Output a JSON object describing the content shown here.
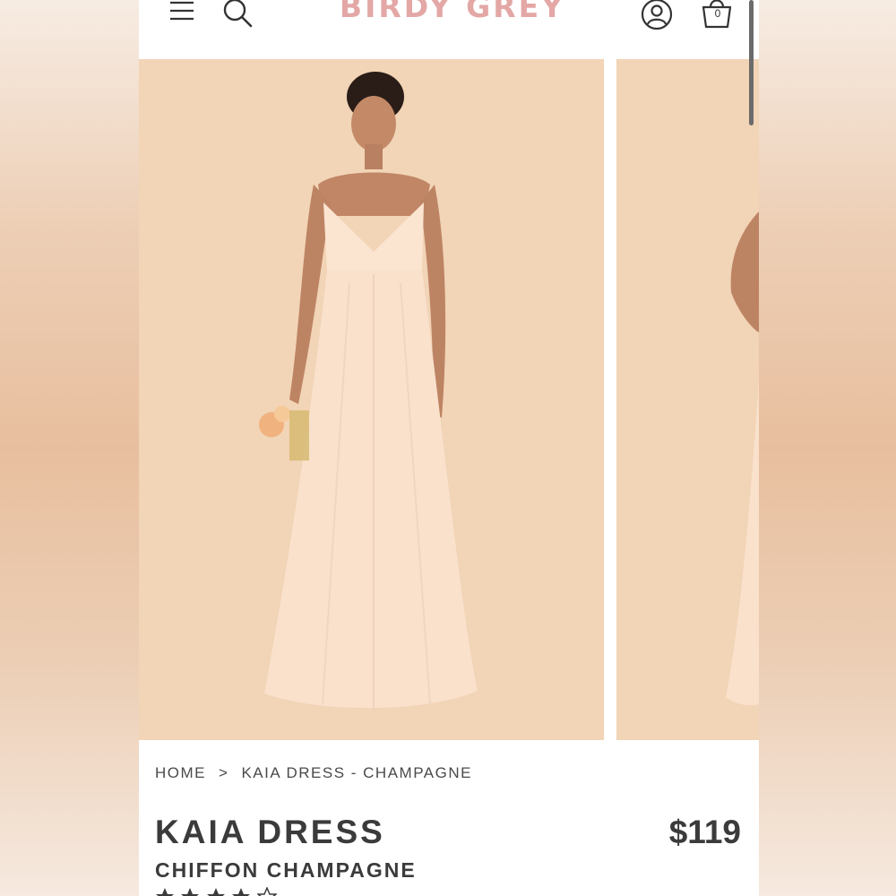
{
  "header": {
    "brand": "BIRDY GREY",
    "menu_icon": "hamburger-menu-icon",
    "search_icon": "search-icon",
    "account_icon": "user-account-icon",
    "cart_icon": "shopping-bag-icon",
    "cart_count": "0"
  },
  "gallery": {
    "slides": [
      {
        "name": "product-image-main"
      },
      {
        "name": "product-image-next"
      }
    ]
  },
  "breadcrumb": {
    "home": "HOME",
    "separator": ">",
    "current": "KAIA DRESS - CHAMPAGNE"
  },
  "product": {
    "title": "KAIA DRESS",
    "price": "$119",
    "subtitle": "CHIFFON CHAMPAGNE",
    "rating_stars_filled": 4.5,
    "rating_stars_total": 5
  },
  "colors": {
    "brand": "#e3a7a5",
    "image_background": "#f2d4b6",
    "text": "#3b3b3b"
  }
}
